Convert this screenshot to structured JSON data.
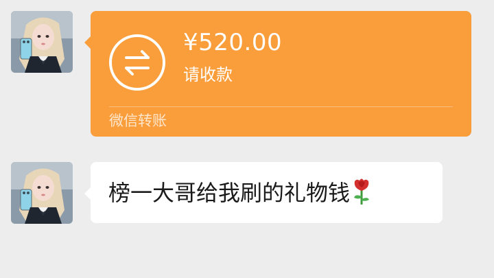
{
  "messages": [
    {
      "sender": "avatar",
      "type": "transfer",
      "transfer": {
        "amount": "¥520.00",
        "status": "请收款",
        "footer": "微信转账",
        "icon": "transfer-arrows-icon",
        "color": "#fa9d3b"
      }
    },
    {
      "sender": "avatar",
      "type": "text",
      "text": "榜一大哥给我刷的礼物钱",
      "emoji": "rose-icon"
    }
  ],
  "colors": {
    "background": "#ededed",
    "transfer_card": "#fa9d3b",
    "text_bubble": "#ffffff"
  }
}
